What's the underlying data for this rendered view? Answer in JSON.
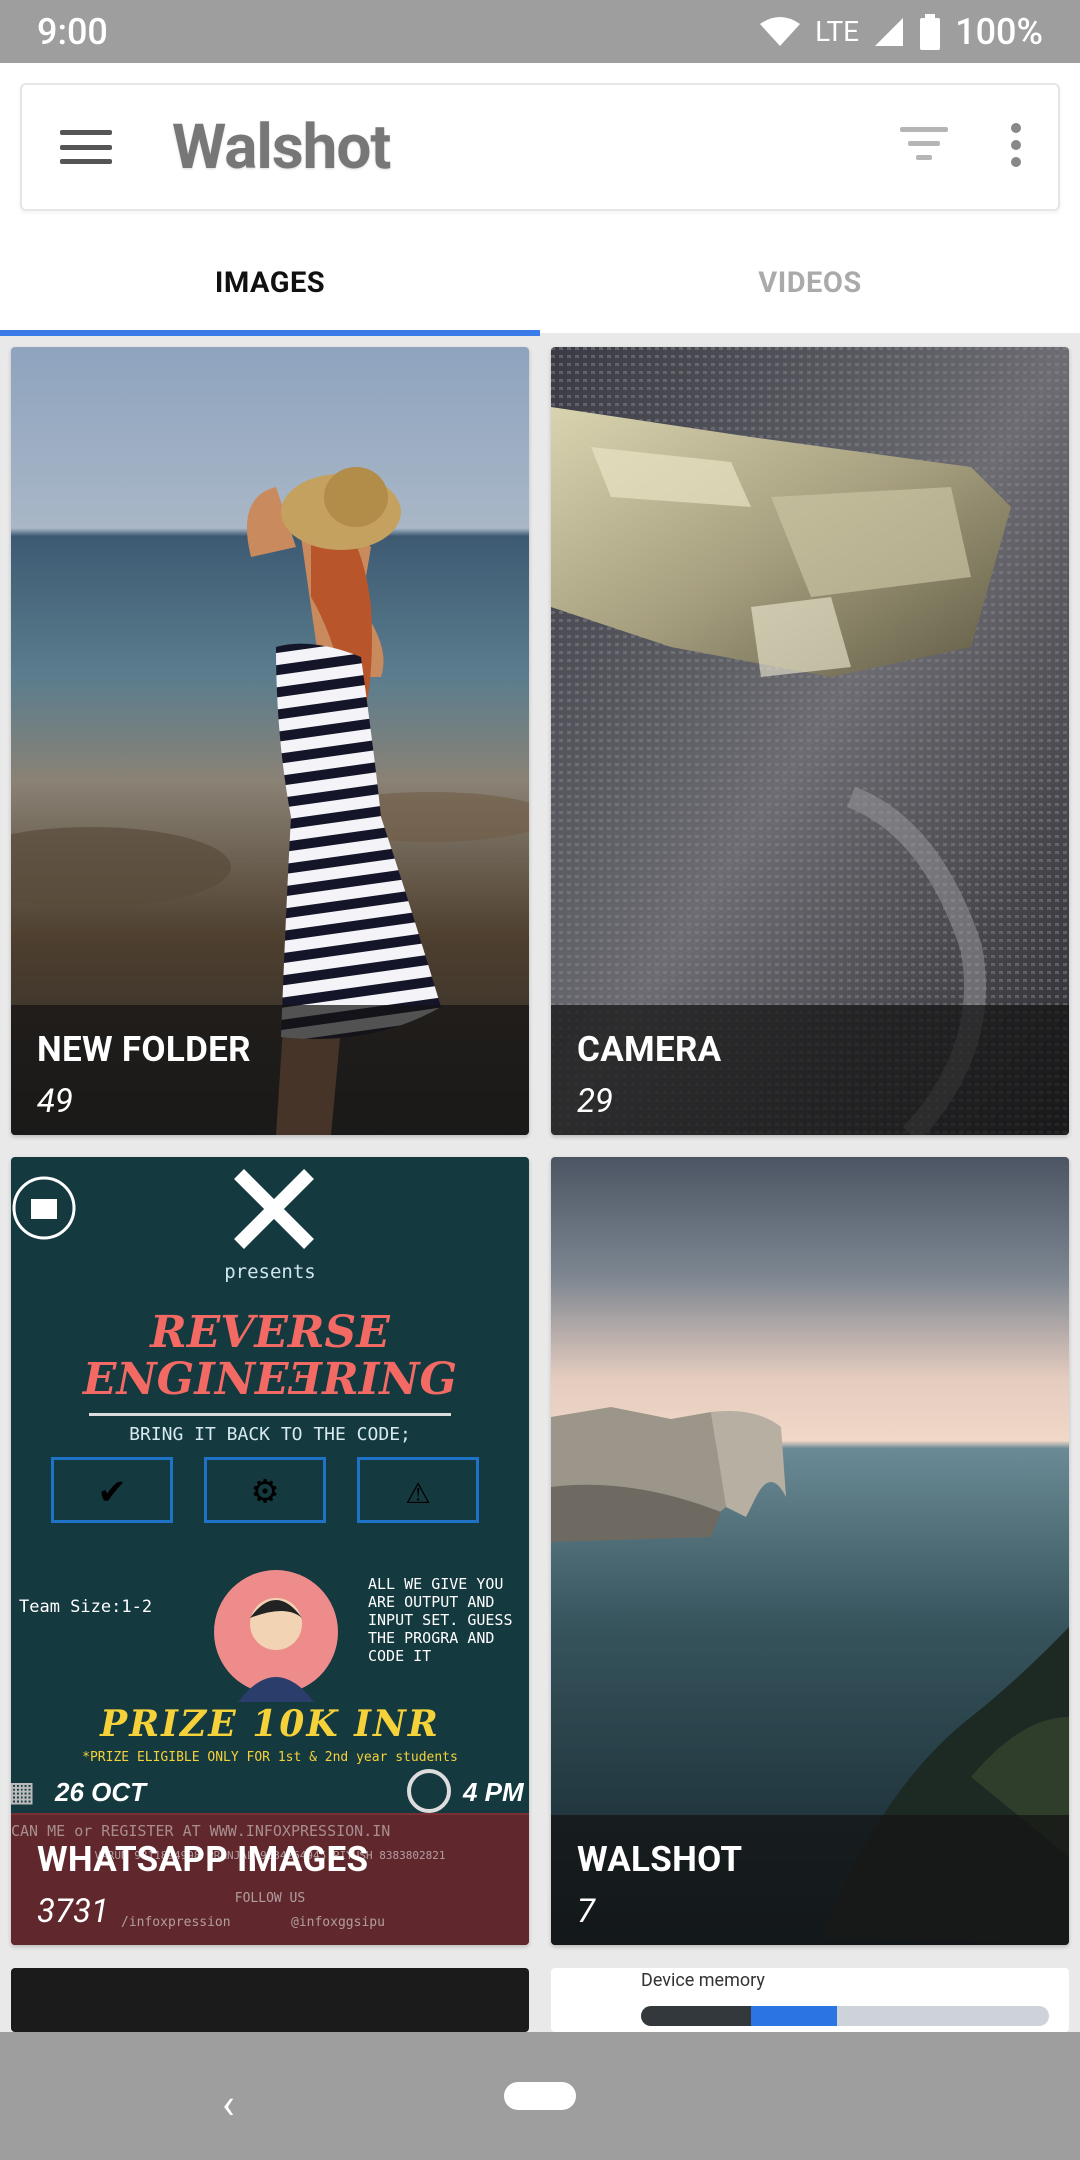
{
  "status": {
    "time": "9:00",
    "network": "LTE",
    "battery": "100%"
  },
  "appbar": {
    "title": "Walshot"
  },
  "tabs": [
    {
      "label": "IMAGES"
    },
    {
      "label": "VIDEOS"
    }
  ],
  "folders": [
    {
      "name": "NEW FOLDER",
      "count": "49"
    },
    {
      "name": "CAMERA",
      "count": "29"
    },
    {
      "name": "WHATSAPP IMAGES",
      "count": "3731"
    },
    {
      "name": "WALSHOT",
      "count": "7"
    }
  ],
  "poster": {
    "presents": "presents",
    "title1": "REVERSE",
    "title2": "ENGINEƎRING",
    "tagline": "BRING IT BACK TO THE CODE;",
    "team": "Team Size:1-2",
    "desc": "ALL WE  GIVE YOU ARE OUTPUT AND INPUT SET. GUESS THE PROGRA AND CODE IT",
    "prize": "PRIZE 10K INR",
    "prize_note": "*PRIZE ELIGIBLE ONLY FOR 1st & 2nd year students",
    "date": "26 OCT",
    "time": "4 PM",
    "register": "CAN ME   or  REGISTER AT WWW.INFOXPRESSION.IN",
    "contacts": "VARUN 9811894998  PRANJAL 9634264945  PIYUSH 8383802821",
    "follow": "FOLLOW US",
    "fb": "/infoxpression",
    "ig": "@infoxggsipu"
  },
  "memory_widget": {
    "label": "Device memory",
    "used_fraction": 0.27,
    "other_fraction": 0.21
  },
  "colors": {
    "accent": "#3a7be8",
    "status_bar": "#9e9e9e"
  }
}
